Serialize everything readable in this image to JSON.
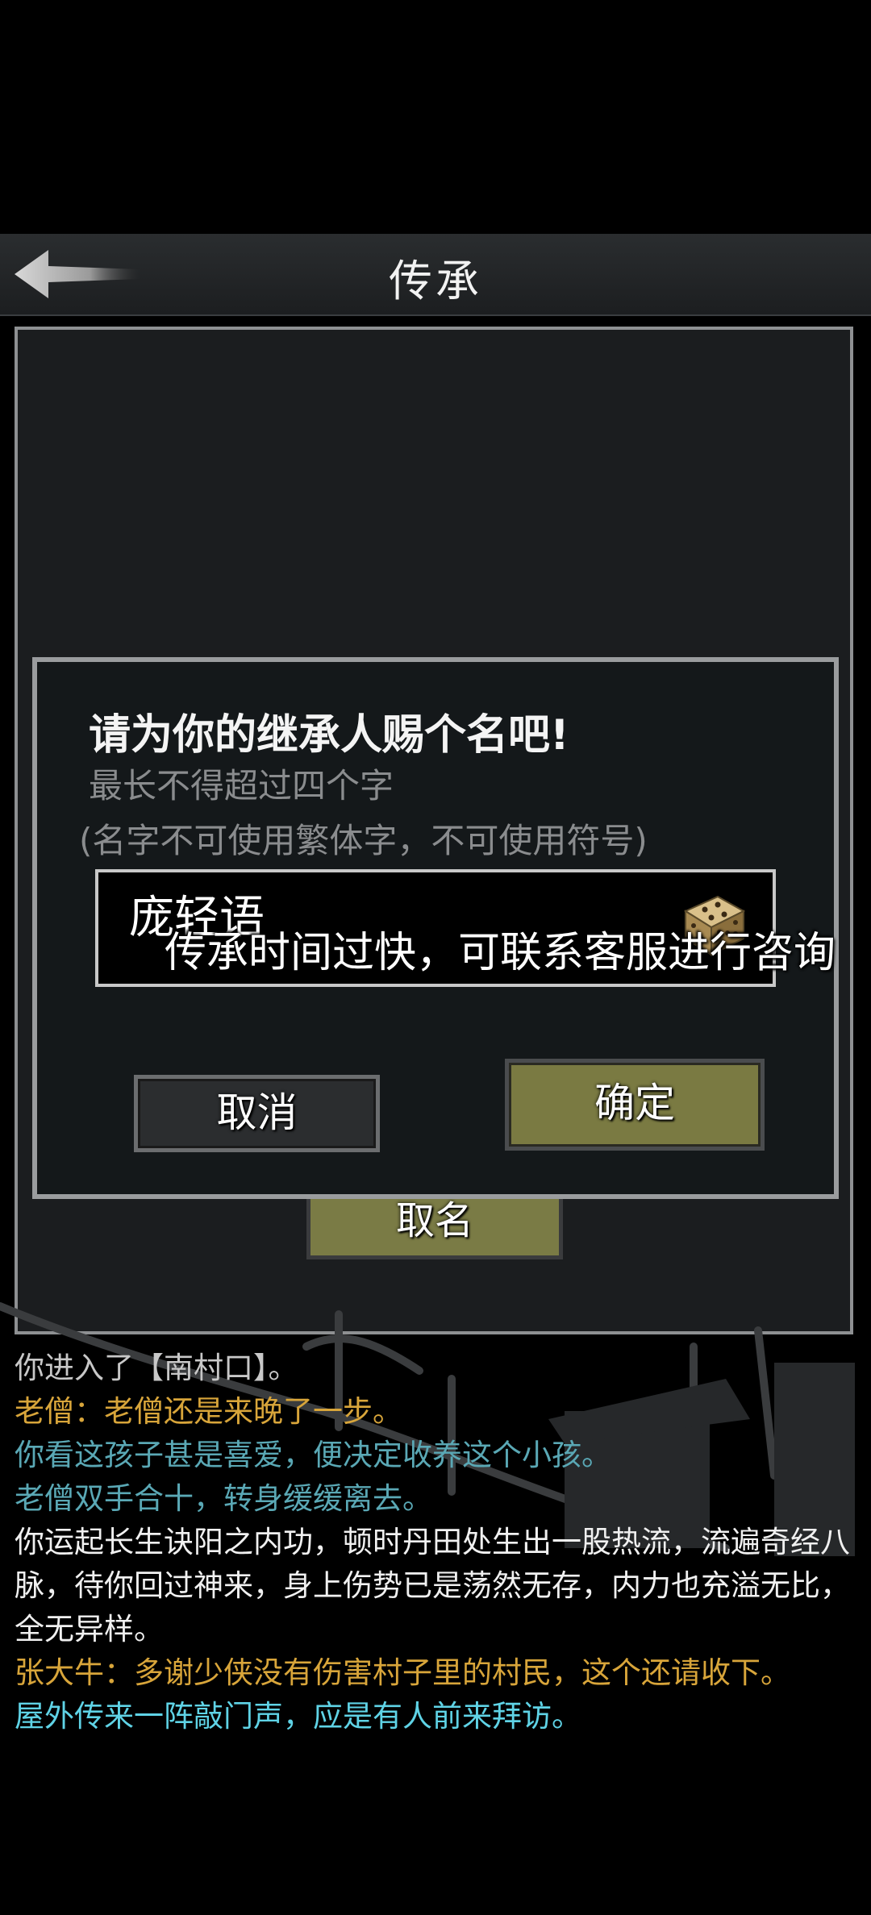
{
  "header": {
    "title": "传承"
  },
  "background_button": {
    "label": "取名"
  },
  "dialog": {
    "title": "请为你的继承人赐个名吧!",
    "subtitle": "最长不得超过四个字",
    "rule": "(名字不可使用繁体字，不可使用符号)",
    "name_value": "庞轻语",
    "toast": "传承时间过快，可联系客服进行咨询",
    "cancel_label": "取消",
    "confirm_label": "确定"
  },
  "log": [
    {
      "text": "你进入了【南村口】。",
      "color": "gray"
    },
    {
      "text": "老僧：老僧还是来晚了一步。",
      "color": "gold"
    },
    {
      "text": "你看这孩子甚是喜爱，便决定收养这个小孩。",
      "color": "teal"
    },
    {
      "text": "老僧双手合十，转身缓缓离去。",
      "color": "teal"
    },
    {
      "text": "你运起长生诀阳之内功，顿时丹田处生出一股热流，流遍奇经八脉，待你回过神来，身上伤势已是荡然无存，内力也充溢无比，全无异样。",
      "color": "white"
    },
    {
      "text": "张大牛：多谢少侠没有伤害村子里的村民，这个还请收下。",
      "color": "gold"
    },
    {
      "text": "屋外传来一阵敲门声，应是有人前来拜访。",
      "color": "cyan"
    }
  ]
}
